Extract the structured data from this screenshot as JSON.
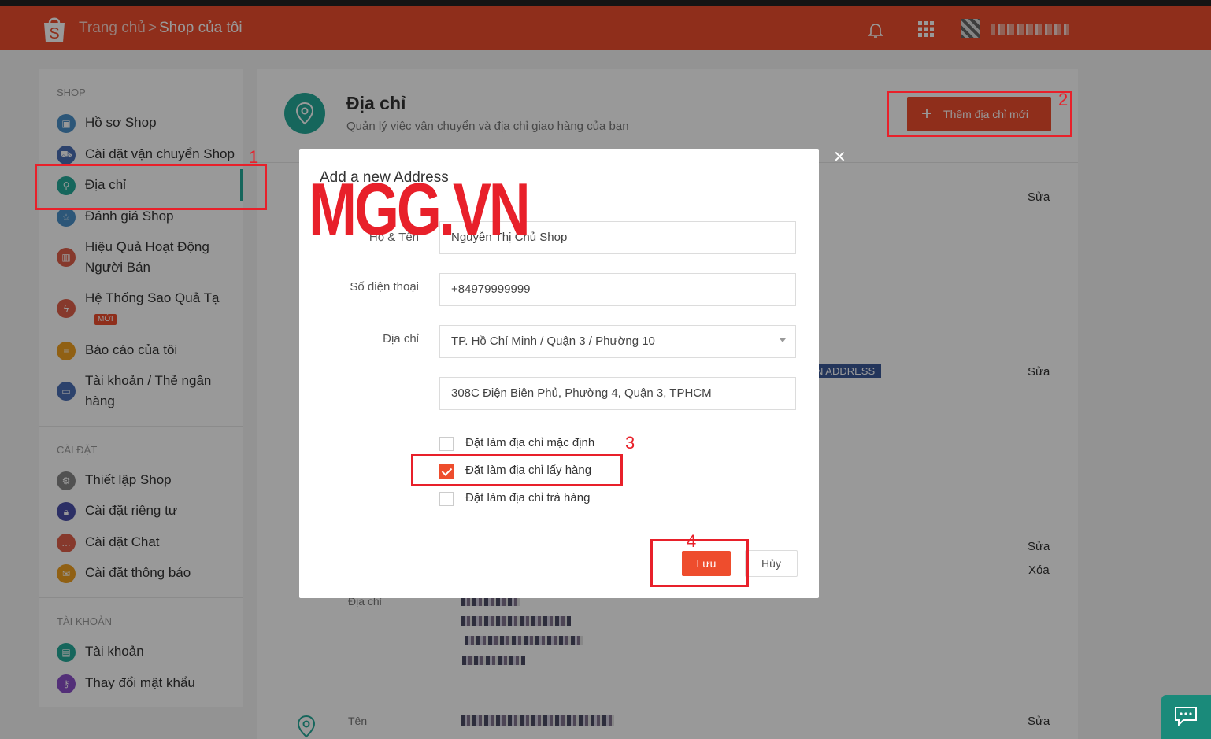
{
  "header": {
    "breadcrumb_home": "Trang chủ",
    "breadcrumb_sep": ">",
    "breadcrumb_current": "Shop của tôi"
  },
  "sidebar": {
    "sections": [
      {
        "title": "SHOP"
      },
      {
        "title": "CÀI ĐẶT"
      },
      {
        "title": "TÀI KHOẢN"
      }
    ],
    "items": [
      {
        "label": "Hồ sơ Shop",
        "icon": "store-icon",
        "color": "#4a90c8"
      },
      {
        "label": "Cài đặt vận chuyển Shop",
        "icon": "truck-icon",
        "color": "#4a6fb5"
      },
      {
        "label": "Địa chỉ",
        "icon": "location-pin-icon",
        "color": "#26aa99",
        "active": true
      },
      {
        "label": "Đánh giá Shop",
        "icon": "star-icon",
        "color": "#4a90c8"
      },
      {
        "label": "Hiệu Quả Hoạt Động Người Bán",
        "icon": "bar-chart-icon",
        "color": "#e0604a"
      },
      {
        "label": "Hệ Thống Sao Quả Tạ",
        "icon": "lightning-icon",
        "color": "#e0604a",
        "badge": "MỚI"
      },
      {
        "label": "Báo cáo của tôi",
        "icon": "report-icon",
        "color": "#f0a020"
      },
      {
        "label": "Tài khoản / Thẻ ngân hàng",
        "icon": "card-icon",
        "color": "#4a6fb5"
      },
      {
        "label": "Thiết lập Shop",
        "icon": "gear-icon",
        "color": "#888888"
      },
      {
        "label": "Cài đặt riêng tư",
        "icon": "lock-icon",
        "color": "#4a4fa8"
      },
      {
        "label": "Cài đặt Chat",
        "icon": "chat-icon",
        "color": "#e0604a"
      },
      {
        "label": "Cài đặt thông báo",
        "icon": "notification-icon",
        "color": "#f0a020"
      },
      {
        "label": "Tài khoản",
        "icon": "id-card-icon",
        "color": "#26aa99"
      },
      {
        "label": "Thay đổi mật khẩu",
        "icon": "key-icon",
        "color": "#8a4fc8"
      }
    ]
  },
  "main": {
    "title": "Địa chỉ",
    "subtitle": "Quản lý việc vận chuyển và địa chỉ giao hàng của bạn",
    "add_button": "Thêm địa chỉ mới",
    "edit_label": "Sửa",
    "delete_label": "Xóa",
    "tag_address": "N ADDRESS",
    "row_label_address": "Địa chỉ",
    "row_label_name": "Tên"
  },
  "modal": {
    "title": "Add a new Address",
    "name_label": "Họ & Tên",
    "name_value": "Nguyễn Thị Chủ Shop",
    "phone_label": "Số điện thoại",
    "phone_value": "+84979999999",
    "address_label": "Địa chỉ",
    "region_value": "TP. Hồ Chí Minh / Quận 3 / Phường 10",
    "street_value": "308C Điện Biên Phủ, Phường 4, Quận 3, TPHCM",
    "checkboxes": [
      {
        "label": "Đặt làm địa chỉ mặc định",
        "checked": false
      },
      {
        "label": "Đặt làm địa chỉ lấy hàng",
        "checked": true
      },
      {
        "label": "Đặt làm địa chỉ trả hàng",
        "checked": false
      }
    ],
    "save_label": "Lưu",
    "cancel_label": "Hủy"
  },
  "watermark": "MGG.VN",
  "annotations": [
    "1",
    "2",
    "3",
    "4"
  ],
  "colors": {
    "brand": "#ee4d2d",
    "accent": "#26aa99",
    "annotation": "#e8202a"
  }
}
